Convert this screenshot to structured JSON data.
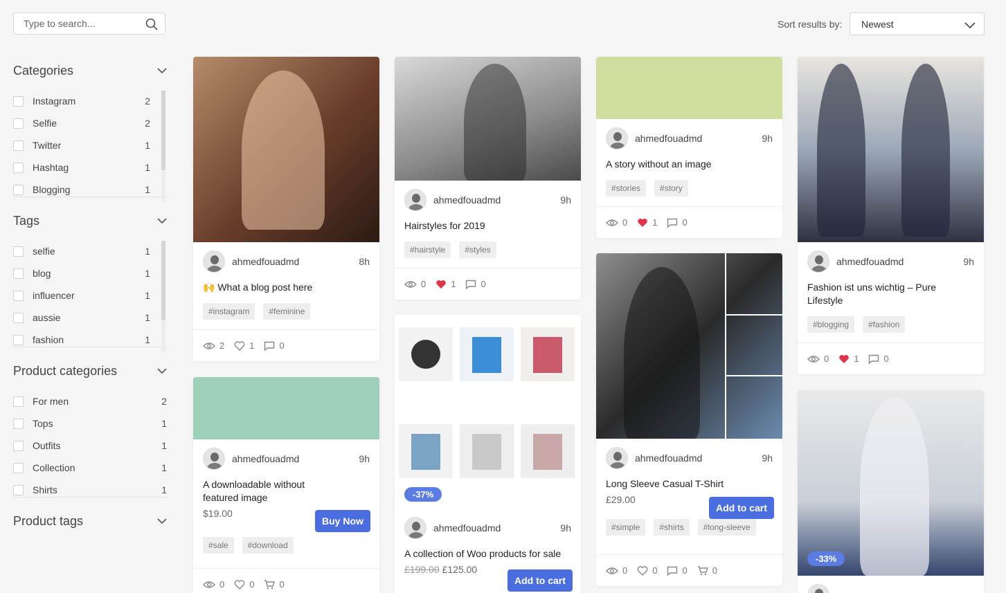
{
  "search": {
    "placeholder": "Type to search..."
  },
  "sort": {
    "label": "Sort results by:",
    "value": "Newest"
  },
  "sidebar": {
    "categories": {
      "title": "Categories",
      "items": [
        {
          "label": "Instagram",
          "count": "2"
        },
        {
          "label": "Selfie",
          "count": "2"
        },
        {
          "label": "Twitter",
          "count": "1"
        },
        {
          "label": "Hashtag",
          "count": "1"
        },
        {
          "label": "Blogging",
          "count": "1"
        }
      ]
    },
    "tags": {
      "title": "Tags",
      "items": [
        {
          "label": "selfie",
          "count": "1"
        },
        {
          "label": "blog",
          "count": "1"
        },
        {
          "label": "influencer",
          "count": "1"
        },
        {
          "label": "aussie",
          "count": "1"
        },
        {
          "label": "fashion",
          "count": "1"
        }
      ]
    },
    "product_categories": {
      "title": "Product categories",
      "items": [
        {
          "label": "For men",
          "count": "2"
        },
        {
          "label": "Tops",
          "count": "1"
        },
        {
          "label": "Outfits",
          "count": "1"
        },
        {
          "label": "Collection",
          "count": "1"
        },
        {
          "label": "Shirts",
          "count": "1"
        }
      ]
    },
    "product_tags": {
      "title": "Product tags"
    }
  },
  "cards": {
    "c1": {
      "author": "ahmedfouadmd",
      "time": "8h",
      "title": "🙌 What a blog post here",
      "tags": [
        "#instagram",
        "#feminine"
      ],
      "views": "2",
      "likes": "1",
      "comments": "0"
    },
    "c2": {
      "author": "ahmedfouadmd",
      "time": "9h",
      "title": "A downloadable without featured image",
      "price": "$19.00",
      "button": "Buy Now",
      "tags": [
        "#sale",
        "#download"
      ],
      "views": "0",
      "likes": "0",
      "cart": "0",
      "media_color": "#9dd0bb"
    },
    "c3": {
      "author": "ahmedfouadmd",
      "time": "9h",
      "title": "Hairstyles for 2019",
      "tags": [
        "#hairstyle",
        "#styles"
      ],
      "views": "0",
      "likes": "1",
      "comments": "0"
    },
    "c4": {
      "author": "ahmedfouadmd",
      "time": "9h",
      "title": "A collection of Woo products for sale",
      "old_price": "£199.00",
      "price": "£125.00",
      "button": "Add to cart",
      "badge": "-37%"
    },
    "c5": {
      "author": "ahmedfouadmd",
      "time": "9h",
      "title": "A story without an image",
      "tags": [
        "#stories",
        "#story"
      ],
      "views": "0",
      "likes": "1",
      "comments": "0",
      "media_color": "#cfde9f"
    },
    "c6": {
      "author": "ahmedfouadmd",
      "time": "9h",
      "title": "Long Sleeve Casual T-Shirt",
      "price": "£29.00",
      "button": "Add to cart",
      "tags": [
        "#simple",
        "#shirts",
        "#long-sleeve"
      ],
      "views": "0",
      "likes": "0",
      "comments": "0",
      "cart": "0"
    },
    "c7": {
      "author": "ahmedfouadmd",
      "time": "9h",
      "title": "Fashion ist uns wichtig – Pure Lifestyle",
      "tags": [
        "#blogging",
        "#fashion"
      ],
      "views": "0",
      "likes": "1",
      "comments": "0"
    },
    "c8": {
      "badge": "-33%"
    }
  },
  "colors": {
    "accent": "#4a6ee0",
    "heart": "#e0344a"
  }
}
